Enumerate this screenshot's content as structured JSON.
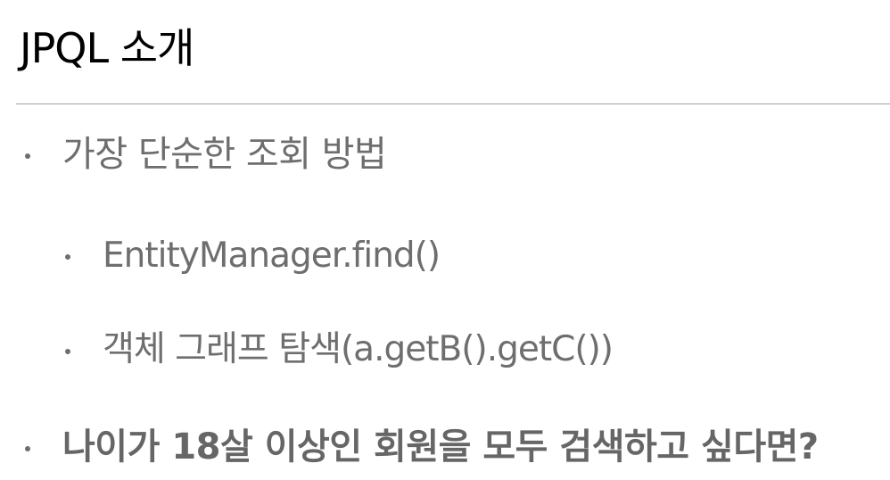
{
  "slide": {
    "title": "JPQL 소개"
  },
  "bullets": [
    {
      "text": "가장 단순한 조회 방법",
      "level": 1
    },
    {
      "text": "EntityManager.find()",
      "level": 2
    },
    {
      "text": "객체 그래프 탐색(a.getB().getC())",
      "level": 2
    },
    {
      "text": "나이가 18살 이상인 회원을 모두 검색하고 싶다면?",
      "level": 1,
      "bold": true
    }
  ],
  "colors": {
    "title": "#000000",
    "body": "#6e6e6e",
    "divider": "#a0a0a0"
  }
}
